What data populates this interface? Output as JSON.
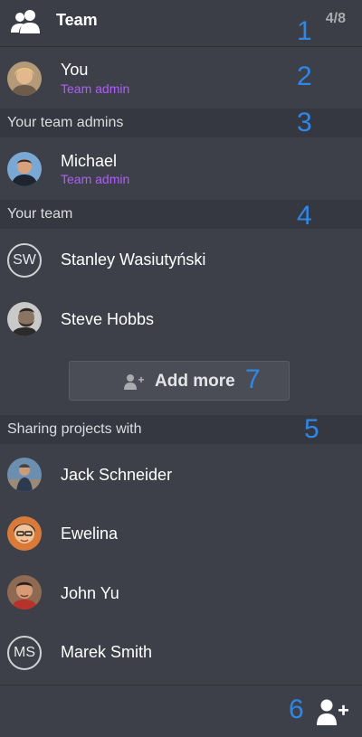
{
  "header": {
    "title": "Team",
    "count": "4/8",
    "icon": "team-icon"
  },
  "markers": [
    "1",
    "2",
    "3",
    "4",
    "5",
    "6",
    "7"
  ],
  "you": {
    "name": "You",
    "role": "Team admin"
  },
  "sections": {
    "admins": "Your team admins",
    "team": "Your team",
    "sharing": "Sharing projects with"
  },
  "admins": [
    {
      "name": "Michael",
      "role": "Team admin"
    }
  ],
  "team": [
    {
      "name": "Stanley Wasiutyński",
      "initials": "SW"
    },
    {
      "name": "Steve Hobbs"
    }
  ],
  "add_more": {
    "label": "Add more",
    "icon": "add-user-icon"
  },
  "sharing": [
    {
      "name": "Jack Schneider"
    },
    {
      "name": "Ewelina"
    },
    {
      "name": "John Yu"
    },
    {
      "name": "Marek Smith",
      "initials": "MS"
    }
  ],
  "footer": {
    "icon": "add-user-icon"
  },
  "colors": {
    "accent": "#b15cff",
    "marker": "#2f87e8",
    "background": "#3d4048"
  }
}
